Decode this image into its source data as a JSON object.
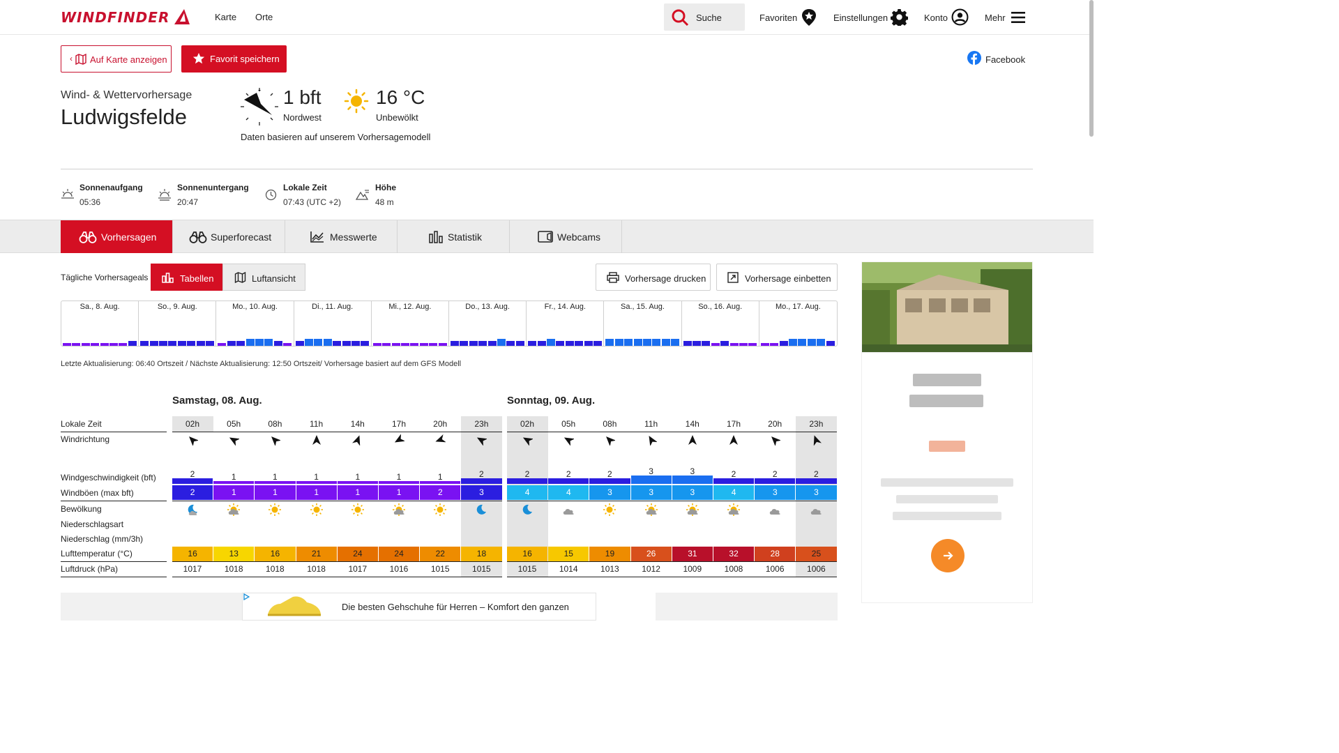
{
  "header": {
    "logo": "WINDFINDER",
    "nav": [
      "Karte",
      "Orte"
    ],
    "search": "Suche",
    "favorites": "Favoriten",
    "settings": "Einstellungen",
    "account": "Konto",
    "more": "Mehr"
  },
  "actions": {
    "show_on_map": "Auf Karte anzeigen",
    "save_favorite": "Favorit speichern",
    "facebook": "Facebook"
  },
  "location": {
    "subtitle": "Wind- & Wettervorhersage",
    "name": "Ludwigsfelde"
  },
  "current": {
    "wind": "1 bft",
    "wind_dir": "Nordwest",
    "temp": "16 °C",
    "condition": "Unbewölkt",
    "note": "Daten basieren auf unserem Vorhersagemodell"
  },
  "info": {
    "sunrise_label": "Sonnenaufgang",
    "sunrise": "05:36",
    "sunset_label": "Sonnenuntergang",
    "sunset": "20:47",
    "localtime_label": "Lokale Zeit",
    "localtime": "07:43 (UTC +2)",
    "altitude_label": "Höhe",
    "altitude": "48 m"
  },
  "tabs": [
    "Vorhersagen",
    "Superforecast",
    "Messwerte",
    "Statistik",
    "Webcams"
  ],
  "toolbar": {
    "label": "Tägliche Vorhersageals",
    "tables": "Tabellen",
    "aerial": "Luftansicht",
    "print": "Vorhersage drucken",
    "embed": "Vorhersage einbetten"
  },
  "overview_days": [
    "Sa., 8. Aug.",
    "So., 9. Aug.",
    "Mo., 10. Aug.",
    "Di., 11. Aug.",
    "Mi., 12. Aug.",
    "Do., 13. Aug.",
    "Fr., 14. Aug.",
    "Sa., 15. Aug.",
    "So., 16. Aug.",
    "Mo., 17. Aug."
  ],
  "update_note": "Letzte Aktualisierung: 06:40 Ortszeit / Nächste Aktualisierung: 12:50 Ortszeit/ Vorhersage basiert auf dem GFS Modell",
  "row_labels": {
    "time": "Lokale Zeit",
    "direction": "Windrichtung",
    "speed": "Windgeschwindigkeit (bft)",
    "gusts": "Windböen (max bft)",
    "clouds": "Bewölkung",
    "precip_type": "Niederschlagsart",
    "precip": "Niederschlag (mm/3h)",
    "temp": "Lufttemperatur (°C)",
    "pressure": "Luftdruck (hPa)"
  },
  "days": [
    {
      "title": "Samstag, 08. Aug.",
      "hours": [
        "02h",
        "05h",
        "08h",
        "11h",
        "14h",
        "17h",
        "20h",
        "23h"
      ],
      "wind_deg": [
        315,
        300,
        315,
        0,
        20,
        240,
        250,
        300
      ],
      "speed": [
        "2",
        "1",
        "1",
        "1",
        "1",
        "1",
        "1",
        "2"
      ],
      "gusts": [
        "2",
        "1",
        "1",
        "1",
        "1",
        "1",
        "2",
        "3"
      ],
      "gust_colors": [
        "#2b1ee0",
        "#7a12f2",
        "#7a12f2",
        "#7a12f2",
        "#7a12f2",
        "#7a12f2",
        "#7a12f2",
        "#2b1ee0"
      ],
      "clouds": [
        "moon-cloud",
        "sun-cloud",
        "sun",
        "sun",
        "sun",
        "sun-cloud",
        "sun",
        "moon"
      ],
      "temp": [
        "16",
        "13",
        "16",
        "21",
        "24",
        "24",
        "22",
        "18"
      ],
      "temp_colors": [
        "#f5b400",
        "#f7d600",
        "#f5b400",
        "#ee8c00",
        "#e57000",
        "#e57000",
        "#ee8c00",
        "#f5b400"
      ],
      "pressure": [
        "1017",
        "1018",
        "1018",
        "1018",
        "1017",
        "1016",
        "1015",
        "1015"
      ]
    },
    {
      "title": "Sonntag, 09. Aug.",
      "hours": [
        "02h",
        "05h",
        "08h",
        "11h",
        "14h",
        "17h",
        "20h",
        "23h"
      ],
      "wind_deg": [
        300,
        300,
        315,
        330,
        0,
        0,
        315,
        340
      ],
      "speed": [
        "2",
        "2",
        "2",
        "3",
        "3",
        "2",
        "2",
        "2"
      ],
      "gusts": [
        "4",
        "4",
        "3",
        "3",
        "3",
        "4",
        "3",
        "3"
      ],
      "gust_colors": [
        "#1fb8f0",
        "#1fb8f0",
        "#1696ee",
        "#1696ee",
        "#1696ee",
        "#1fb8f0",
        "#1696ee",
        "#1696ee"
      ],
      "clouds": [
        "moon",
        "cloud",
        "sun",
        "sun-cloud",
        "sun-cloud",
        "sun-cloud",
        "cloud",
        "cloud"
      ],
      "temp": [
        "16",
        "15",
        "19",
        "26",
        "31",
        "32",
        "28",
        "25"
      ],
      "temp_colors": [
        "#f5b400",
        "#f7c800",
        "#ee8c00",
        "#d8501c",
        "#b8102a",
        "#b8102a",
        "#d0401e",
        "#d8501c"
      ],
      "pressure": [
        "1015",
        "1014",
        "1013",
        "1012",
        "1009",
        "1008",
        "1006",
        "1006"
      ]
    }
  ],
  "colors": {
    "brand": "#d40f23",
    "speed_bar_low": "#7a12f2",
    "speed_bar_mid": "#2b1ee0",
    "speed_bar_high": "#1a6ef0"
  },
  "ad": {
    "text": "Die besten Gehschuhe für Herren – Komfort den ganzen"
  }
}
